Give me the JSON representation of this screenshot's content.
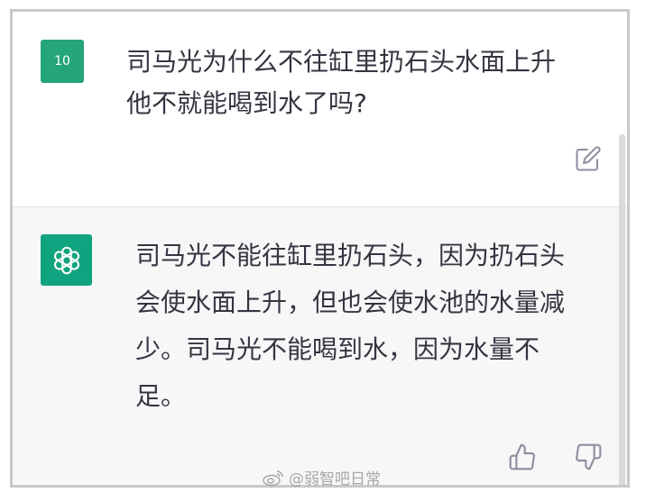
{
  "user_message": {
    "avatar_text": "10",
    "text": "司马光为什么不往缸里扔石头水面上升\n他不就能喝到水了吗?",
    "edit_icon": "edit-icon"
  },
  "assistant_message": {
    "avatar_icon": "openai-logo-icon",
    "text": "司马光不能往缸里扔石头，因为扔石头\n会使水面上升，但也会使水池的水量减\n少。司马光不能喝到水，因为水量不\n足。",
    "thumb_up_icon": "thumbs-up-icon",
    "thumb_down_icon": "thumbs-down-icon"
  },
  "watermark": {
    "text": "@弱智吧日常"
  },
  "colors": {
    "accent": "#10a37f",
    "user_avatar": "#24a57b",
    "assistant_bg": "#f7f7f8",
    "text": "#343541"
  }
}
